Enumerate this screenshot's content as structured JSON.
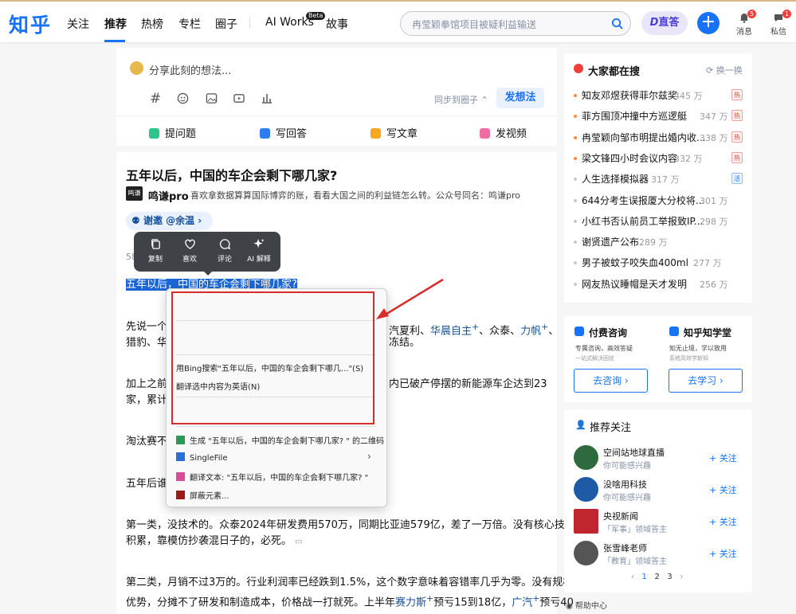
{
  "header": {
    "logo": "知乎",
    "nav": [
      "关注",
      "推荐",
      "热榜",
      "专栏",
      "圈子",
      "AI Works",
      "故事"
    ],
    "beta": "Beta",
    "search_placeholder": "冉莹颖拳馆项目被疑利益输送",
    "zhida": "直答",
    "messages_label": "消息",
    "messages_count": "5",
    "dm_label": "私信",
    "dm_count": "1"
  },
  "composer": {
    "placeholder": "分享此刻的想法...",
    "sync": "同步到圈子",
    "submit": "发想法",
    "actions": [
      "提问题",
      "写回答",
      "写文章",
      "发视频"
    ]
  },
  "article": {
    "title": "五年以后，中国的车企会剩下哪几家?",
    "author": "鸣谦pro",
    "author_bio": "喜欢拿数据算算国际博弈的账，看看大国之间的利益链怎么转。公众号同名：鸣谦pro",
    "invite": "谢邀 @余温",
    "count_prefix": "58",
    "selected": "五年以后，中国的车企会剩下哪几家?",
    "p1a": "先说一个",
    "p1b": "汽夏利、",
    "p1_link1": "华晨自主",
    "p1c": "、众泰、",
    "p1_link2": "力帆",
    "p1d": "、",
    "p1e": "猎豹、华",
    "p1f": "冻结。",
    "p2a": "加上之前",
    "p2b": "内已破产停摆的新能源车企达到23",
    "p2c": "家，累计",
    "p3": "淘汰赛不",
    "p4": "五年后谁",
    "p5a": "第一类，没技术的。众泰2024年研发费用570万，同期比亚迪579亿，差了一万倍。没有核心技术",
    "p5b": "积累，靠模仿抄袭混日子的，必死。",
    "p6a": "第二类，月销不过3万的。行业利润率已经跌到1.5%，这个数字意味着容错率几乎为零。没有规模",
    "p6b": "优势，分摊不了研发和制造成本，价格战一打就死。上半年",
    "p6_link1": "赛力斯",
    "p6c": "预亏15到18亿，",
    "p6_link2": "广汽",
    "p6d": "预亏40"
  },
  "selection_toolbar": [
    "复制",
    "喜欢",
    "评论",
    "AI 解释"
  ],
  "context_menu": {
    "bing": "用Bing搜索\"五年以后，中国的车企会剩下哪几...\"(S)",
    "translate_en": "翻译选中内容为英语(N)",
    "qr": "生成 \"五年以后，中国的车企会剩下哪几家? \" 的二维码",
    "singlefile": "SingleFile",
    "translate_text": "翻译文本: \"五年以后，中国的车企会剩下哪几家? \"",
    "block": "屏蔽元素..."
  },
  "hot_search": {
    "title": "大家都在搜",
    "refresh": "换一换",
    "items": [
      {
        "text": "知友邓煜获得菲尔兹奖",
        "count": "445 万",
        "tag": "热"
      },
      {
        "text": "菲方围顶冲撞中方巡逻艇",
        "count": "347 万",
        "tag": "热"
      },
      {
        "text": "冉莹颖向邹市明提出婚内收...",
        "count": "338 万",
        "tag": "热"
      },
      {
        "text": "梁文锋四小时会议内容",
        "count": "332 万",
        "tag": "热"
      },
      {
        "text": "人生选择模拟器",
        "count": "317 万",
        "tag": "活"
      },
      {
        "text": "644分考生误报厦大分校将...",
        "count": "301 万",
        "tag": ""
      },
      {
        "text": "小红书否认前员工举报致IP...",
        "count": "298 万",
        "tag": ""
      },
      {
        "text": "谢贤遗产公布",
        "count": "289 万",
        "tag": ""
      },
      {
        "text": "男子被蚊子咬失血400ml",
        "count": "277 万",
        "tag": ""
      },
      {
        "text": "网友热议睡帽是天才发明",
        "count": "256 万",
        "tag": ""
      }
    ]
  },
  "services": {
    "consult_title": "付费咨询",
    "consult_desc1": "专属咨询，高效答疑",
    "consult_desc2": "一站式解决困扰",
    "consult_btn": "去咨询",
    "learn_title": "知乎知学堂",
    "learn_desc1": "知无止境，学以致用",
    "learn_desc2": "系统高效学新知",
    "learn_btn": "去学习"
  },
  "recommend": {
    "title": "推荐关注",
    "follow": "关注",
    "users": [
      {
        "name": "空间站地球直播",
        "desc": "你可能感兴趣"
      },
      {
        "name": "没啥用科技",
        "desc": "你可能感兴趣"
      },
      {
        "name": "央视新闻",
        "desc": "「军事」领域答主"
      },
      {
        "name": "张雪峰老师",
        "desc": "「教育」领域答主"
      }
    ],
    "pages": [
      "1",
      "2",
      "3"
    ]
  },
  "help": "帮助中心",
  "colors": {
    "accent": "#1772f6",
    "selection": "#1b66d6",
    "annotation": "#d62c2c"
  }
}
